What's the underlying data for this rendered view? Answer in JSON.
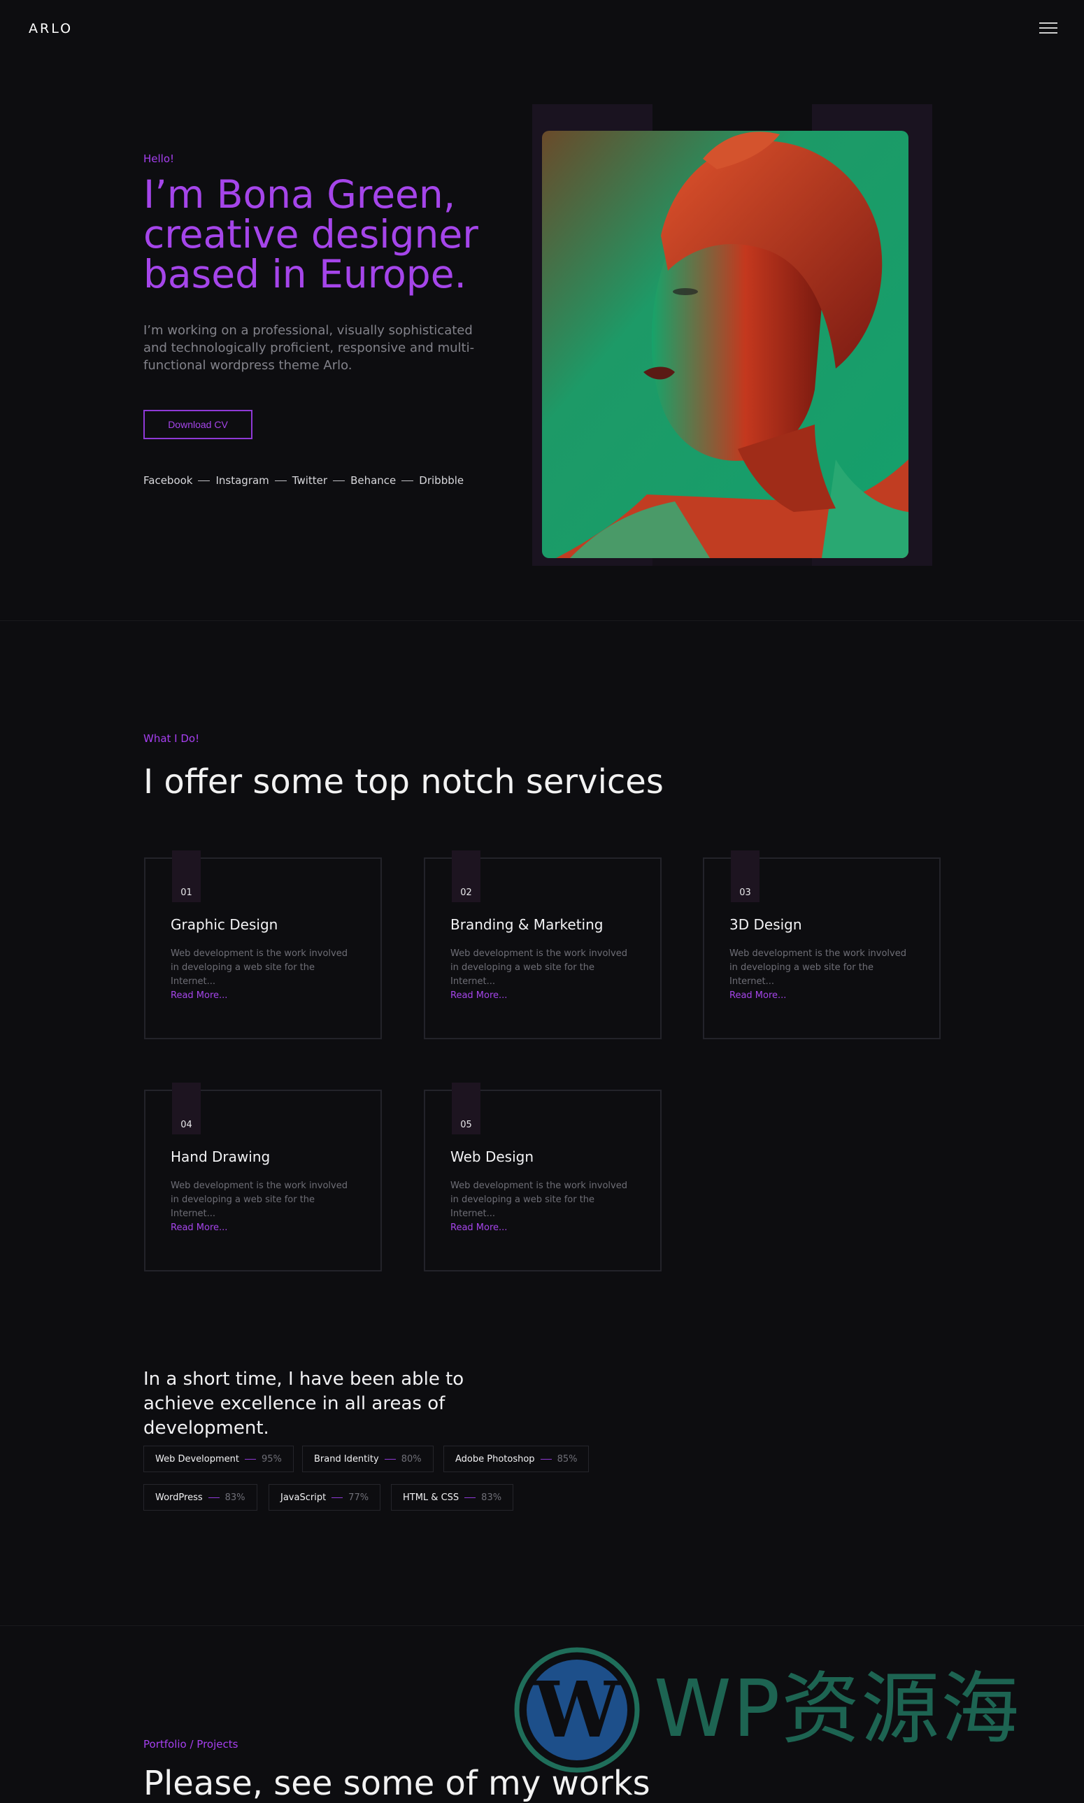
{
  "header": {
    "logo": "ARLO",
    "menu_icon": "hamburger-menu-icon"
  },
  "hero": {
    "eyebrow": "Hello!",
    "title": "I’m Bona Green, creative designer based in Europe.",
    "description": "I’m working on a professional, visually sophisticated and technologically proficient, responsive and multi-functional wordpress theme Arlo.",
    "cta_label": "Download CV",
    "socials": [
      "Facebook",
      "Instagram",
      "Twitter",
      "Behance",
      "Dribbble"
    ],
    "portrait": "woman-portrait-photo"
  },
  "services": {
    "eyebrow": "What I Do!",
    "title": "I offer some top notch services",
    "items": [
      {
        "num": "01",
        "title": "Graphic Design",
        "desc": "Web development is the work involved in developing a web site for the Internet...",
        "more": "Read More..."
      },
      {
        "num": "02",
        "title": "Branding & Marketing",
        "desc": "Web development is the work involved in developing a web site for the Internet...",
        "more": "Read More..."
      },
      {
        "num": "03",
        "title": "3D Design",
        "desc": "Web development is the work involved in developing a web site for the Internet...",
        "more": "Read More..."
      },
      {
        "num": "04",
        "title": "Hand Drawing",
        "desc": "Web development is the work involved in developing a web site for the Internet...",
        "more": "Read More..."
      },
      {
        "num": "05",
        "title": "Web Design",
        "desc": "Web development is the work involved in developing a web site for the Internet...",
        "more": "Read More..."
      }
    ]
  },
  "skills": {
    "title": "In a short time, I have been able to achieve excellence in all areas of development.",
    "items": [
      {
        "name": "Web Development",
        "percent": "95%"
      },
      {
        "name": "Brand Identity",
        "percent": "80%"
      },
      {
        "name": "Adobe Photoshop",
        "percent": "85%"
      },
      {
        "name": "WordPress",
        "percent": "83%"
      },
      {
        "name": "JavaScript",
        "percent": "77%"
      },
      {
        "name": "HTML & CSS",
        "percent": "83%"
      }
    ]
  },
  "portfolio": {
    "eyebrow": "Portfolio / Projects",
    "title": "Please, see some of my works"
  },
  "watermark": {
    "text": "WP资源海",
    "icon": "wordpress-logo-icon"
  },
  "colors": {
    "accent": "#a545ea",
    "background": "#0d0d10",
    "card_border": "#23232a"
  }
}
